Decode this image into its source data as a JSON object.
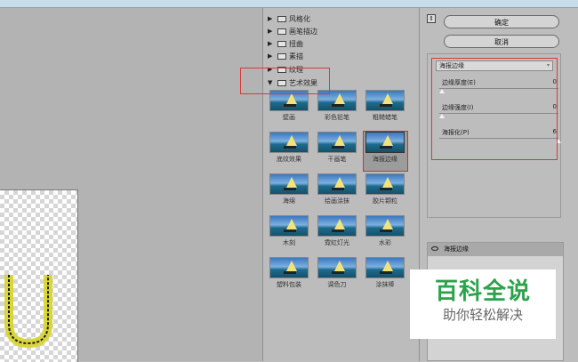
{
  "gallery": {
    "folders": [
      {
        "label": "风格化",
        "expanded": false
      },
      {
        "label": "画笔描边",
        "expanded": false
      },
      {
        "label": "扭曲",
        "expanded": false
      },
      {
        "label": "素描",
        "expanded": false
      },
      {
        "label": "纹理",
        "expanded": false
      },
      {
        "label": "艺术效果",
        "expanded": true
      }
    ],
    "thumbs": [
      {
        "label": "壁画"
      },
      {
        "label": "彩色铅笔"
      },
      {
        "label": "粗糙蜡笔"
      },
      {
        "label": "底纹效果"
      },
      {
        "label": "干画笔"
      },
      {
        "label": "海报边缘",
        "selected": true
      },
      {
        "label": "海绵"
      },
      {
        "label": "绘画涂抹"
      },
      {
        "label": "胶片颗粒"
      },
      {
        "label": "木刻"
      },
      {
        "label": "霓虹灯光"
      },
      {
        "label": "水彩"
      },
      {
        "label": "塑料包装"
      },
      {
        "label": "调色刀"
      },
      {
        "label": "涂抹棒"
      }
    ]
  },
  "controls": {
    "ok_label": "确定",
    "cancel_label": "取消",
    "filter_select": "海报边缘",
    "params": [
      {
        "label": "边缘厚度(E)",
        "value": "0",
        "level": 0
      },
      {
        "label": "边缘强度(I)",
        "value": "0",
        "level": 0
      },
      {
        "label": "海报化(P)",
        "value": "6",
        "level": 1
      }
    ]
  },
  "layers": {
    "items": [
      {
        "label": "海报边缘"
      }
    ]
  },
  "watermark": {
    "title": "百科全说",
    "subtitle": "助你轻松解决"
  }
}
